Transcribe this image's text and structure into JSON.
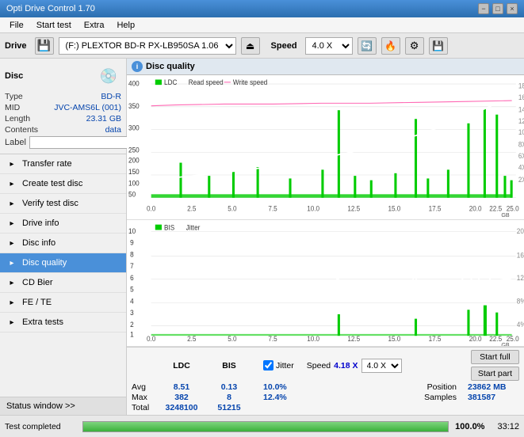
{
  "titlebar": {
    "title": "Opti Drive Control 1.70",
    "minimize": "−",
    "maximize": "□",
    "close": "×"
  },
  "menu": {
    "items": [
      "File",
      "Start test",
      "Extra",
      "Help"
    ]
  },
  "toolbar": {
    "drive_label": "Drive",
    "drive_value": "(F:)  PLEXTOR BD-R  PX-LB950SA 1.06",
    "speed_label": "Speed",
    "speed_value": "4.0 X"
  },
  "disc": {
    "title": "Disc",
    "type_label": "Type",
    "type_value": "BD-R",
    "mid_label": "MID",
    "mid_value": "JVC-AMS6L (001)",
    "length_label": "Length",
    "length_value": "23.31 GB",
    "contents_label": "Contents",
    "contents_value": "data",
    "label_label": "Label"
  },
  "nav": {
    "items": [
      {
        "id": "transfer-rate",
        "label": "Transfer rate",
        "icon": "📈"
      },
      {
        "id": "create-test-disc",
        "label": "Create test disc",
        "icon": "💿"
      },
      {
        "id": "verify-test-disc",
        "label": "Verify test disc",
        "icon": "✔"
      },
      {
        "id": "drive-info",
        "label": "Drive info",
        "icon": "ℹ"
      },
      {
        "id": "disc-info",
        "label": "Disc info",
        "icon": "📋"
      },
      {
        "id": "disc-quality",
        "label": "Disc quality",
        "icon": "★",
        "active": true
      },
      {
        "id": "cd-bier",
        "label": "CD Bier",
        "icon": "🍺"
      },
      {
        "id": "fe-te",
        "label": "FE / TE",
        "icon": "📊"
      },
      {
        "id": "extra-tests",
        "label": "Extra tests",
        "icon": "🔬"
      }
    ],
    "status_window": "Status window >>"
  },
  "disc_quality": {
    "title": "Disc quality",
    "legend1": {
      "ldc": "LDC",
      "read_speed": "Read speed",
      "write_speed": "Write speed"
    },
    "legend2": {
      "bis": "BIS",
      "jitter": "Jitter"
    }
  },
  "stats": {
    "columns": [
      "LDC",
      "BIS"
    ],
    "jitter_label": "Jitter",
    "jitter_checked": true,
    "speed_label": "Speed",
    "speed_value": "4.18 X",
    "speed_dropdown": "4.0 X",
    "rows": [
      {
        "label": "Avg",
        "ldc": "8.51",
        "bis": "0.13",
        "jitter": "10.0%"
      },
      {
        "label": "Max",
        "ldc": "382",
        "bis": "8",
        "jitter": "12.4%"
      },
      {
        "label": "Total",
        "ldc": "3248100",
        "bis": "51215",
        "jitter": ""
      }
    ],
    "position_label": "Position",
    "position_value": "23862 MB",
    "samples_label": "Samples",
    "samples_value": "381587",
    "btn_start_full": "Start full",
    "btn_start_part": "Start part"
  },
  "progress": {
    "percent": "100.0%",
    "fill_width": "100%",
    "time": "33:12",
    "status": "Test completed"
  },
  "colors": {
    "ldc_bar": "#00cc00",
    "bis_bar": "#00dd00",
    "read_speed": "#ffffff",
    "write_speed": "#ff69b4",
    "jitter_line": "#ffffff",
    "accent": "#4a90d9",
    "active_nav": "#4a90d9"
  }
}
